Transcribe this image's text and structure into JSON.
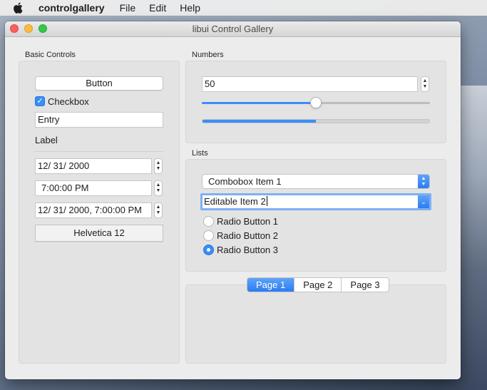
{
  "menubar": {
    "app_name": "controlgallery",
    "menus": [
      "File",
      "Edit",
      "Help"
    ]
  },
  "window": {
    "title": "libui Control Gallery"
  },
  "basic_controls": {
    "group_title": "Basic Controls",
    "button_label": "Button",
    "checkbox_label": "Checkbox",
    "checkbox_checked": true,
    "entry_value": "Entry",
    "label_text": "Label",
    "date_value": "12/ 31/ 2000",
    "time_value": "7:00:00 PM",
    "datetime_value": "12/ 31/ 2000,   7:00:00 PM",
    "font_button_label": "Helvetica 12"
  },
  "numbers": {
    "group_title": "Numbers",
    "spinbox_value": "50",
    "slider_value": 50,
    "progress_value": 50,
    "range_max": 100
  },
  "lists": {
    "group_title": "Lists",
    "combobox_value": "Combobox Item 1",
    "editable_combobox_value": "Editable Item 2",
    "radio_buttons": [
      {
        "label": "Radio Button 1",
        "selected": false
      },
      {
        "label": "Radio Button 2",
        "selected": false
      },
      {
        "label": "Radio Button 3",
        "selected": true
      }
    ]
  },
  "tabs": {
    "items": [
      "Page 1",
      "Page 2",
      "Page 3"
    ],
    "selected_index": 0
  },
  "colors": {
    "accent": "#3a8ef6"
  }
}
